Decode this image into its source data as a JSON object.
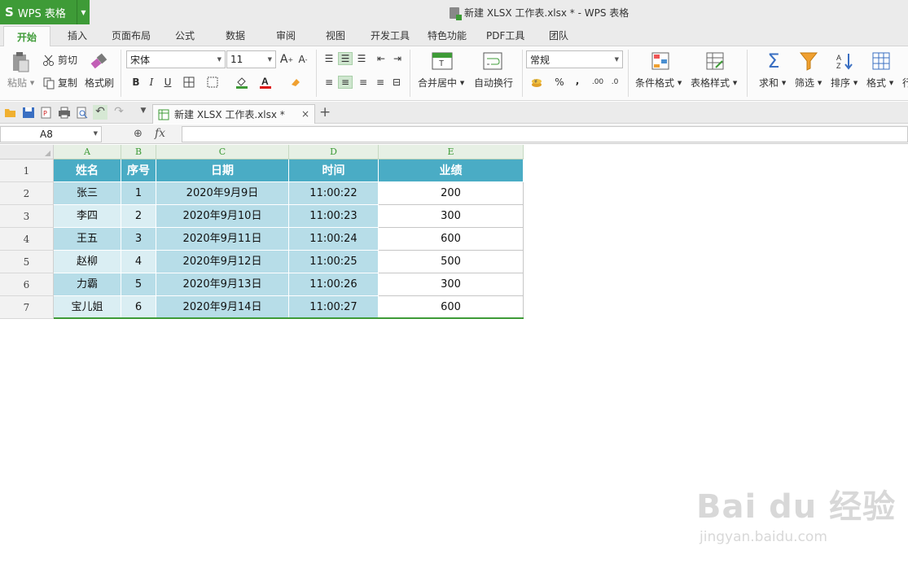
{
  "titlebar": {
    "app_logo": "S",
    "app_name": "WPS 表格",
    "window_title": "新建 XLSX 工作表.xlsx * - WPS 表格",
    "accent": "#3e9b37"
  },
  "menu": {
    "tabs": [
      "开始",
      "插入",
      "页面布局",
      "公式",
      "数据",
      "审阅",
      "视图",
      "开发工具",
      "特色功能",
      "PDF工具",
      "团队"
    ],
    "active": "开始"
  },
  "ribbon": {
    "paste": "粘贴",
    "cut": "剪切",
    "copy": "复制",
    "format_painter": "格式刷",
    "font_name": "宋体",
    "font_size": "11",
    "bold": "B",
    "italic": "I",
    "underline": "U",
    "merge_center": "合并居中",
    "wrap_text": "自动换行",
    "number_format": "常规",
    "percent": "%",
    "comma": ",",
    "inc_decimal": ".00",
    "dec_decimal": ".0",
    "conditional_format": "条件格式",
    "table_style": "表格样式",
    "sum": "求和",
    "filter": "筛选",
    "sort": "排序",
    "format": "格式",
    "row_col_partial": "行"
  },
  "doc_tab": {
    "label": "新建 XLSX 工作表.xlsx *",
    "close": "×",
    "new": "+"
  },
  "formula_bar": {
    "cell_ref": "A8",
    "fx": "fx",
    "value": ""
  },
  "sheet": {
    "columns": [
      "A",
      "B",
      "C",
      "D",
      "E"
    ],
    "rows": [
      "1",
      "2",
      "3",
      "4",
      "5",
      "6",
      "7"
    ],
    "header": [
      "姓名",
      "序号",
      "日期",
      "时间",
      "业绩"
    ],
    "data": [
      [
        "张三",
        "1",
        "2020年9月9日",
        "11:00:22",
        "200"
      ],
      [
        "李四",
        "2",
        "2020年9月10日",
        "11:00:23",
        "300"
      ],
      [
        "王五",
        "3",
        "2020年9月11日",
        "11:00:24",
        "600"
      ],
      [
        "赵柳",
        "4",
        "2020年9月12日",
        "11:00:25",
        "500"
      ],
      [
        "力霸",
        "5",
        "2020年9月13日",
        "11:00:26",
        "300"
      ],
      [
        "宝儿姐",
        "6",
        "2020年9月14日",
        "11:00:27",
        "600"
      ]
    ],
    "colors": {
      "header": "#4aacc5",
      "band_dark": "#b7dde8",
      "band_light": "#daeef3"
    }
  },
  "watermark": {
    "main": "Bai du 经验",
    "sub": "jingyan.baidu.com"
  }
}
